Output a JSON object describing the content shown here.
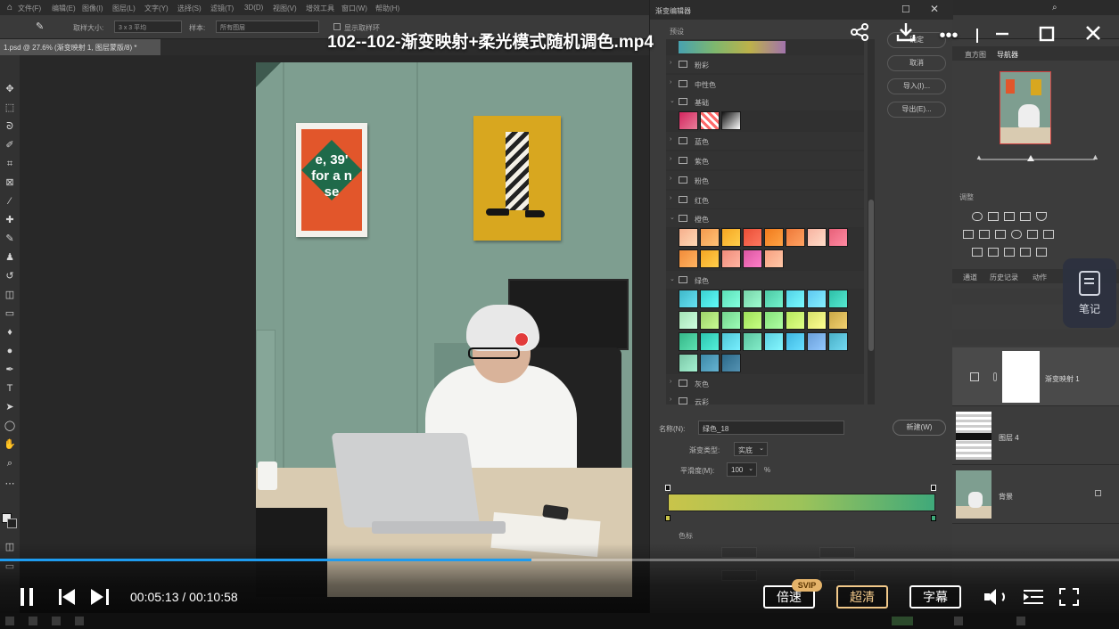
{
  "video": {
    "title": "102--102-渐变映射+柔光模式随机调色.mp4",
    "current_time": "00:05:13",
    "total_time": "00:10:58",
    "time_separator": "/",
    "progress_fraction": 0.475,
    "accent_color": "#1e9cf0",
    "controls": {
      "speed_label": "倍速",
      "speed_badge": "SVIP",
      "quality_label": "超清",
      "subtitle_label": "字幕"
    },
    "notes_label": "笔记",
    "top_icons": [
      "share-icon",
      "download-icon",
      "more-icon",
      "minimize-icon",
      "maximize-icon",
      "close-icon"
    ]
  },
  "photoshop": {
    "menu": [
      "文件(F)",
      "编辑(E)",
      "图像(I)",
      "图层(L)",
      "文字(Y)",
      "选择(S)",
      "滤镜(T)",
      "3D(D)",
      "视图(V)",
      "增效工具",
      "窗口(W)",
      "帮助(H)"
    ],
    "options": {
      "sample_size_label": "取样大小:",
      "sample_size_value": "3 x 3 平均",
      "sample_label": "样本:",
      "sample_value": "所有图层",
      "show_ring": "显示取样环"
    },
    "document_tab": "1.psd @ 27.6% (渐变映射 1, 图层蒙版/8) *",
    "poster_text": "e, 39' for a n se",
    "right_panel": {
      "tabs_top": [
        "直方图",
        "导航器"
      ],
      "adjust_label": "调整",
      "tabs_mid": [
        "通道",
        "历史记录",
        "动作"
      ],
      "layers": [
        {
          "name": "渐变映射 1"
        },
        {
          "name": "图层 4"
        },
        {
          "name": "背景"
        }
      ]
    }
  },
  "gradient_editor": {
    "title": "渐变编辑器",
    "presets_label": "预设",
    "folders": [
      {
        "name": "粉彩",
        "expanded": false
      },
      {
        "name": "中性色",
        "expanded": false
      },
      {
        "name": "基础",
        "expanded": true,
        "swatches": [
          "#d4245e",
          "#ff6a6a",
          "#111111"
        ]
      },
      {
        "name": "蓝色",
        "expanded": false
      },
      {
        "name": "紫色",
        "expanded": false
      },
      {
        "name": "粉色",
        "expanded": false
      },
      {
        "name": "红色",
        "expanded": false
      },
      {
        "name": "橙色",
        "expanded": true,
        "swatches": [
          "#f6b08d",
          "#f39a4e",
          "#f5a623",
          "#e94f37",
          "#f07b1d",
          "#ee7a3a",
          "#f7b4a1",
          "#e8627a",
          "#f28c3a",
          "#f5a623",
          "#f08c7a",
          "#d956a0",
          "#f7a080"
        ]
      },
      {
        "name": "绿色",
        "expanded": true,
        "swatches": [
          "#3fb8c9",
          "#3ad1d0",
          "#5ce0b7",
          "#76d3a8",
          "#4cc9a4",
          "#52d2e6",
          "#5ec8f0",
          "#2ec0a8",
          "#a6e3b7",
          "#9ed26a",
          "#74d48e",
          "#9fdf5a",
          "#86e07a",
          "#b8e85e",
          "#d6e06a",
          "#caa847",
          "#35b889",
          "#2cc6b0",
          "#4fc6d6",
          "#5bc4a0",
          "#5ccfe0",
          "#3fb6e0",
          "#6a9fd8",
          "#4ab0c8",
          "#7cc8a8",
          "#3d8aa8",
          "#2c6a8a"
        ]
      },
      {
        "name": "灰色",
        "expanded": false
      },
      {
        "name": "云彩",
        "expanded": false
      }
    ],
    "buttons": {
      "ok": "确定",
      "cancel": "取消",
      "import": "导入(I)...",
      "export": "导出(E)...",
      "new": "新建(W)"
    },
    "name_label": "名称(N):",
    "name_value": "绿色_18",
    "type_label": "渐变类型:",
    "type_value": "实底",
    "smoothness_label": "平滑度(M):",
    "smoothness_value": "100",
    "smoothness_unit": "%",
    "stops_label": "色标",
    "gradient_colors": [
      "#c9c44a",
      "#9cc35a",
      "#3fa97a"
    ]
  }
}
